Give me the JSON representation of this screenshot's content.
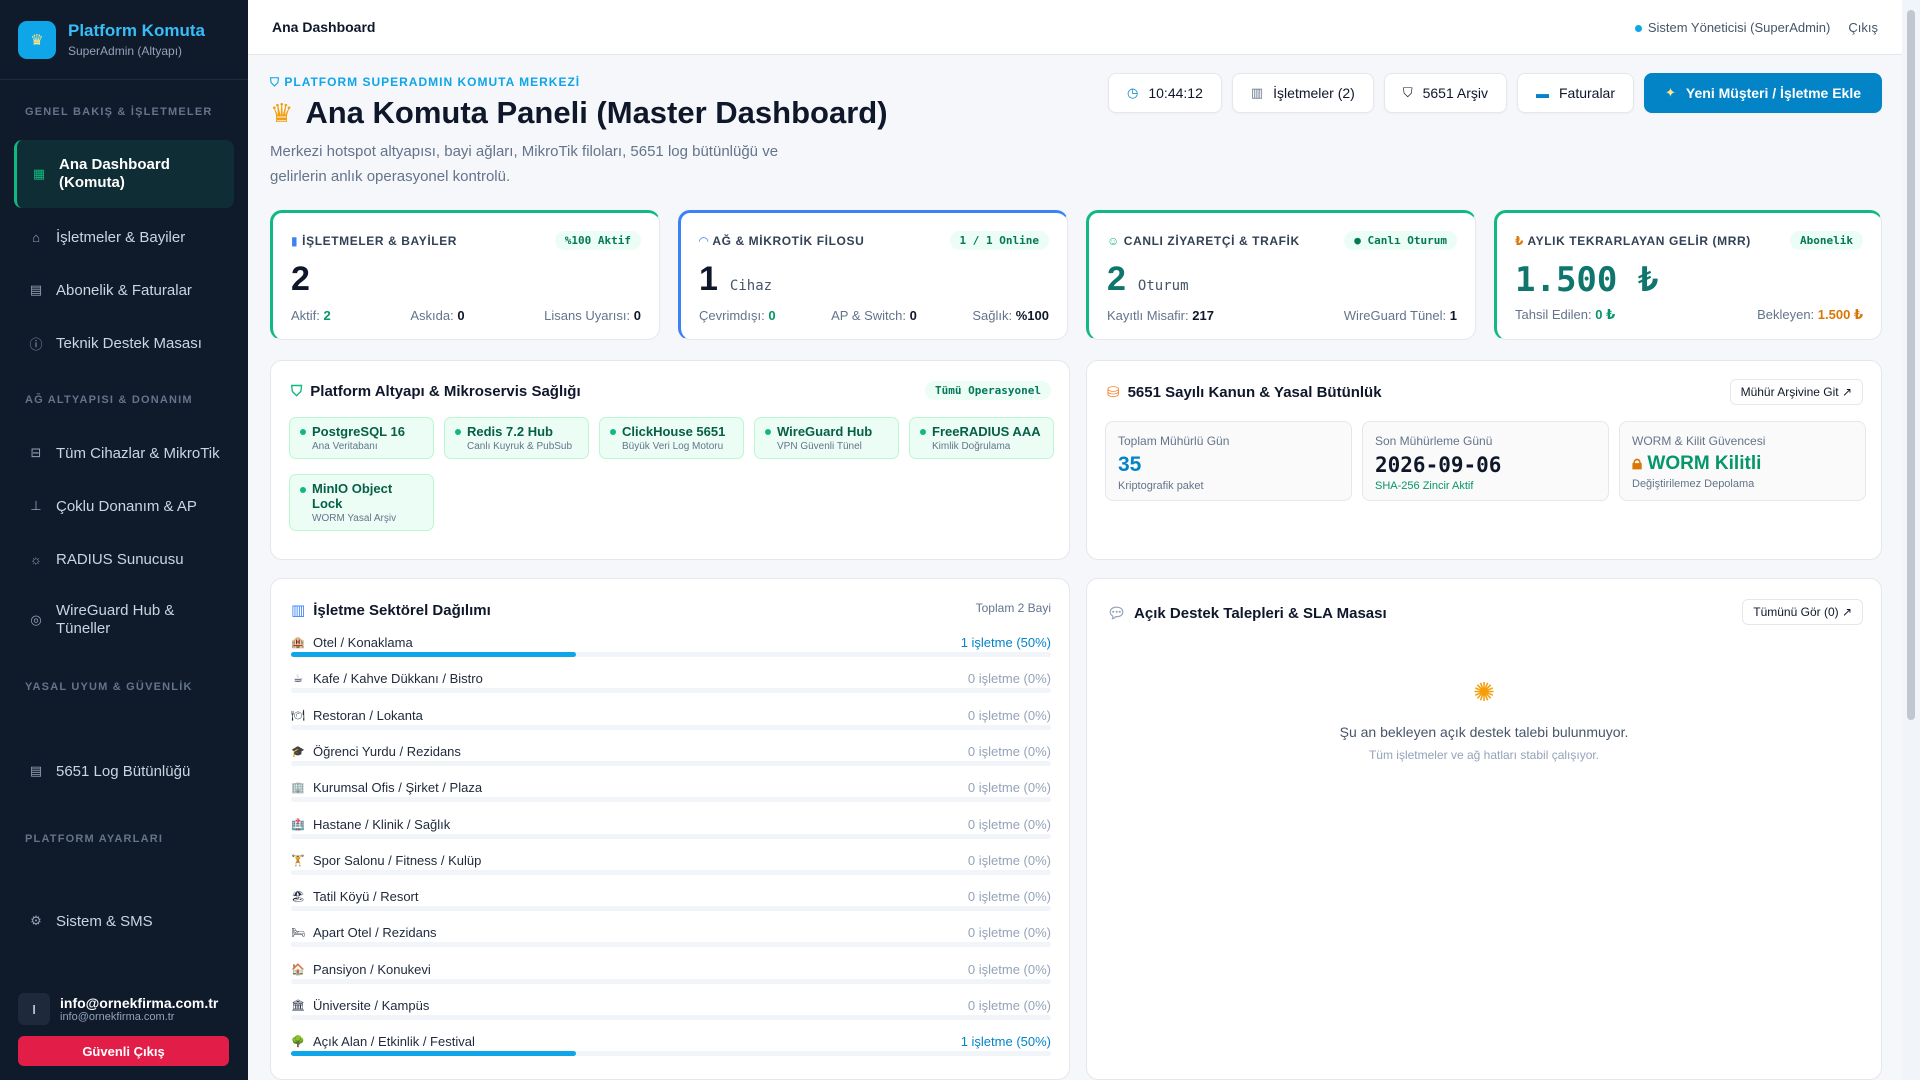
{
  "brand": {
    "title": "Platform Komuta",
    "subtitle": "SuperAdmin (Altyapı)"
  },
  "sidebar": {
    "sections": [
      "GENEL BAKIŞ & İŞLETMELER",
      "AĞ ALTYAPISI & DONANIM",
      "YASAL UYUM & GÜVENLİK",
      "PLATFORM AYARLARI"
    ],
    "items": [
      {
        "label": "Ana Dashboard (Komuta)",
        "line1": "Ana Dashboard",
        "line2": "(Komuta)",
        "icon": "grid-icon",
        "active": true
      },
      {
        "label": "İşletmeler & Bayiler",
        "icon": "home-icon"
      },
      {
        "label": "Abonelik & Faturalar",
        "icon": "document-icon"
      },
      {
        "label": "Teknik Destek Masası",
        "icon": "help-circle-icon"
      },
      {
        "label": "Tüm Cihazlar & MikroTik",
        "icon": "router-icon"
      },
      {
        "label": "Çoklu Donanım & AP",
        "icon": "antenna-icon"
      },
      {
        "label": "RADIUS Sunucusu",
        "icon": "sun-icon"
      },
      {
        "label": "WireGuard Hub & Tüneller",
        "line1": "WireGuard Hub &",
        "line2": "Tüneller",
        "icon": "location-pin-icon"
      },
      {
        "label": "5651 Log Bütünlüğü",
        "icon": "document-icon"
      },
      {
        "label": "Sistem & SMS",
        "icon": "gear-icon"
      }
    ],
    "user": {
      "initial": "I",
      "email": "info@ornekfirma.com.tr",
      "email_sub": "info@ornekfirma.com.tr"
    },
    "logout_label": "Güvenli Çıkış"
  },
  "topbar": {
    "breadcrumb": "Ana Dashboard",
    "role": "Sistem Yöneticisi (SuperAdmin)",
    "logout": "Çıkış"
  },
  "header": {
    "kicker": "PLATFORM SUPERADMIN KOMUTA MERKEZİ",
    "title": "Ana Komuta Paneli (Master Dashboard)",
    "desc": "Merkezi hotspot altyapısı, bayi ağları, MikroTik filoları, 5651 log bütünlüğü ve gelirlerin anlık operasyonel kontrolü.",
    "time": "10:44:12",
    "btn_businesses": "İşletmeler (2)",
    "btn_archive": "5651 Arşiv",
    "btn_invoices": "Faturalar",
    "btn_new": "Yeni Müşteri / İşletme Ekle"
  },
  "kpis": {
    "businesses": {
      "title": "İŞLETMELER & BAYİLER",
      "pill": "%100 Aktif",
      "value": "2",
      "f1_label": "Aktif:",
      "f1_val": "2",
      "f2_label": "Askıda:",
      "f2_val": "0",
      "f3_label": "Lisans Uyarısı:",
      "f3_val": "0"
    },
    "network": {
      "title": "AĞ & MİKROTİK FİLOSU",
      "pill": "1 / 1 Online",
      "value": "1",
      "unit": "Cihaz",
      "f1_label": "Çevrimdışı:",
      "f1_val": "0",
      "f2_label": "AP & Switch:",
      "f2_val": "0",
      "f3_label": "Sağlık:",
      "f3_val": "%100"
    },
    "traffic": {
      "title": "CANLI ZİYARETÇİ & TRAFİK",
      "pill": "Canlı Oturum",
      "value": "2",
      "unit": "Oturum",
      "f1_label": "Kayıtlı Misafir:",
      "f1_val": "217",
      "f3_label": "WireGuard Tünel:",
      "f3_val": "1"
    },
    "mrr": {
      "title": "AYLIK TEKRARLAYAN GELİR (MRR)",
      "pill": "Abonelik",
      "value": "1.500 ₺",
      "f1_label": "Tahsil Edilen:",
      "f1_val": "0 ₺",
      "f3_label": "Bekleyen:",
      "f3_val": "1.500 ₺"
    }
  },
  "infra": {
    "title": "Platform Altyapı & Mikroservis Sağlığı",
    "pill": "Tümü Operasyonel",
    "services": [
      {
        "name": "PostgreSQL 16",
        "sub": "Ana Veritabanı"
      },
      {
        "name": "Redis 7.2 Hub",
        "sub": "Canlı Kuyruk & PubSub"
      },
      {
        "name": "ClickHouse 5651",
        "sub": "Büyük Veri Log Motoru"
      },
      {
        "name": "WireGuard Hub",
        "sub": "VPN Güvenli Tünel"
      },
      {
        "name": "FreeRADIUS AAA",
        "sub": "Kimlik Doğrulama"
      },
      {
        "name": "MinIO Object Lock",
        "line1": "MinIO Object",
        "line2": "Lock",
        "sub": "WORM Yasal Arşiv"
      }
    ]
  },
  "law": {
    "title": "5651 Sayılı Kanun & Yasal Bütünlük",
    "btn": "Mühür Arşivine Git ↗",
    "stats": [
      {
        "label": "Toplam Mühürlü Gün",
        "value": "35",
        "sub": "Kriptografik paket"
      },
      {
        "label": "Son Mühürleme Günü",
        "value": "2026-09-06",
        "sub": "SHA-256 Zincir Aktif"
      },
      {
        "label": "WORM & Kilit Güvencesi",
        "value": "WORM Kilitli",
        "sub": "Değiştirilemez Depolama"
      }
    ]
  },
  "sectors": {
    "title": "İşletme Sektörel Dağılımı",
    "total": "Toplam 2 Bayi",
    "rows": [
      {
        "label": "Otel / Konaklama",
        "value": "1 işletme (50%)",
        "pct": 50,
        "icon": "hotel-icon",
        "glyph": "🏨"
      },
      {
        "label": "Kafe / Kahve Dükkanı / Bistro",
        "value": "0 işletme (0%)",
        "pct": 0,
        "icon": "coffee-icon",
        "glyph": "☕"
      },
      {
        "label": "Restoran / Lokanta",
        "value": "0 işletme (0%)",
        "pct": 0,
        "icon": "restaurant-icon",
        "glyph": "🍽"
      },
      {
        "label": "Öğrenci Yurdu / Rezidans",
        "value": "0 işletme (0%)",
        "pct": 0,
        "icon": "graduation-cap-icon",
        "glyph": "🎓"
      },
      {
        "label": "Kurumsal Ofis / Şirket / Plaza",
        "value": "0 işletme (0%)",
        "pct": 0,
        "icon": "office-icon",
        "glyph": "🏢"
      },
      {
        "label": "Hastane / Klinik / Sağlık",
        "value": "0 işletme (0%)",
        "pct": 0,
        "icon": "hospital-icon",
        "glyph": "🏥"
      },
      {
        "label": "Spor Salonu / Fitness / Kulüp",
        "value": "0 işletme (0%)",
        "pct": 0,
        "icon": "dumbbell-icon",
        "glyph": "🏋"
      },
      {
        "label": "Tatil Köyü / Resort",
        "value": "0 işletme (0%)",
        "pct": 0,
        "icon": "resort-icon",
        "glyph": "🏖"
      },
      {
        "label": "Apart Otel / Rezidans",
        "value": "0 işletme (0%)",
        "pct": 0,
        "icon": "apartment-icon",
        "glyph": "🛏"
      },
      {
        "label": "Pansiyon / Konukevi",
        "value": "0 işletme (0%)",
        "pct": 0,
        "icon": "guesthouse-icon",
        "glyph": "🏠"
      },
      {
        "label": "Üniversite / Kampüs",
        "value": "0 işletme (0%)",
        "pct": 0,
        "icon": "university-icon",
        "glyph": "🏛"
      },
      {
        "label": "Açık Alan / Etkinlik / Festival",
        "value": "1 işletme (50%)",
        "pct": 50,
        "icon": "tree-icon",
        "glyph": "🌳"
      }
    ]
  },
  "support": {
    "title": "Açık Destek Talepleri & SLA Masası",
    "btn": "Tümünü Gör (0) ↗",
    "empty_title": "Şu an bekleyen açık destek talebi bulunmuyor.",
    "empty_sub": "Tüm işletmeler ve ağ hatları stabil çalışıyor."
  },
  "colors": {
    "accent": "#0ea5e9",
    "primary": "#0284c7",
    "success": "#10b981",
    "sidebar_bg": "#0f1a2a",
    "danger": "#e11d48"
  }
}
